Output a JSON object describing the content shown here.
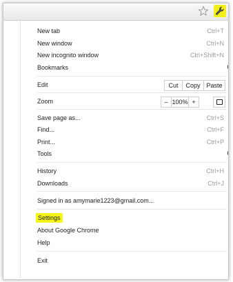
{
  "colors": {
    "highlight": "#f5f51c",
    "shortcut_text": "#9a9a9a",
    "menu_text": "#222222"
  },
  "toolbar": {
    "star_icon": "star-outline-icon",
    "menu_icon": "wrench-icon"
  },
  "menu": {
    "new_tab": {
      "label": "New tab",
      "shortcut": "Ctrl+T"
    },
    "new_window": {
      "label": "New window",
      "shortcut": "Ctrl+N"
    },
    "new_incognito": {
      "label": "New incognito window",
      "shortcut": "Ctrl+Shift+N"
    },
    "bookmarks": {
      "label": "Bookmarks"
    },
    "edit": {
      "label": "Edit",
      "cut": "Cut",
      "copy": "Copy",
      "paste": "Paste"
    },
    "zoom": {
      "label": "Zoom",
      "minus": "–",
      "level": "100%",
      "plus": "+"
    },
    "save_page": {
      "label": "Save page as...",
      "shortcut": "Ctrl+S"
    },
    "find": {
      "label": "Find...",
      "shortcut": "Ctrl+F"
    },
    "print": {
      "label": "Print...",
      "shortcut": "Ctrl+P"
    },
    "tools": {
      "label": "Tools"
    },
    "history": {
      "label": "History",
      "shortcut": "Ctrl+H"
    },
    "downloads": {
      "label": "Downloads",
      "shortcut": "Ctrl+J"
    },
    "signed_in": {
      "label": "Signed in as amymarie1223@gmail.com..."
    },
    "settings": {
      "label": "Settings"
    },
    "about": {
      "label": "About Google Chrome"
    },
    "help": {
      "label": "Help"
    },
    "exit": {
      "label": "Exit"
    }
  }
}
